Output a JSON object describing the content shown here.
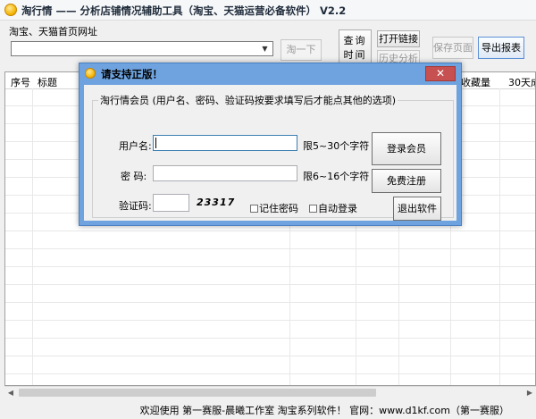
{
  "window": {
    "title": "淘行情 —— 分析店铺情况辅助工具（淘宝、天猫运营必备软件） V2.2",
    "icon": "coin-icon"
  },
  "toolbar": {
    "url_label": "淘宝、天猫首页网址",
    "url_value": "",
    "go_label": "淘一下",
    "query_label": "查询时间",
    "open_link_label": "打开链接",
    "history_label": "历史分析",
    "save_page_label": "保存页面",
    "export_label": "导出报表"
  },
  "grid": {
    "columns": [
      "序号",
      "标题",
      "收藏量",
      "30天成"
    ]
  },
  "status": {
    "text": "欢迎使用 第一赛服-晨曦工作室 淘宝系列软件！ 官网：www.d1kf.com（第一赛服）"
  },
  "dialog": {
    "title": "请支持正版！",
    "close_label": "✕",
    "group_label": "淘行情会员 (用户名、密码、验证码按要求填写后才能点其他的选项)",
    "username_label": "用户名:",
    "username_value": "",
    "username_hint": "限5~30个字符",
    "password_label": "密  码:",
    "password_value": "",
    "password_hint": "限6~16个字符",
    "captcha_label": "验证码:",
    "captcha_value": "",
    "captcha_code": "23317",
    "remember_label": "记住密码",
    "auto_login_label": "自动登录",
    "login_button": "登录会员",
    "register_button": "免费注册",
    "exit_button": "退出软件"
  },
  "colors": {
    "dialog_frame": "#6ea3df",
    "close_button": "#c75050",
    "window_bg": "#f0f0f0"
  }
}
